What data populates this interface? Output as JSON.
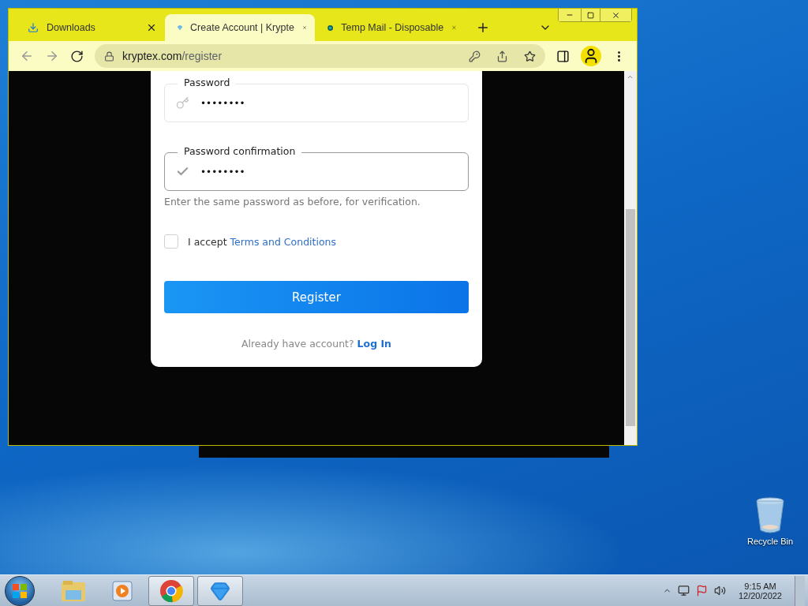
{
  "browser": {
    "tabs": [
      {
        "title": "Downloads",
        "kind": "download",
        "selected": false
      },
      {
        "title": "Create Account | Krypte",
        "kind": "gem",
        "selected": true
      },
      {
        "title": "Temp Mail - Disposable",
        "kind": "mail",
        "selected": false
      }
    ],
    "url_host": "kryptex.com",
    "url_path": "/register"
  },
  "form": {
    "fields": [
      {
        "label": "Password",
        "value": "••••••••",
        "kind": "key",
        "focused": false
      },
      {
        "label": "Password confirmation",
        "value": "••••••••",
        "kind": "check",
        "focused": true
      }
    ],
    "hint": "Enter the same password as before, for verification.",
    "terms": {
      "checked": false,
      "text": "I accept",
      "link": "Terms and Conditions"
    },
    "submit": "Register",
    "login_prompt": "Already have account?",
    "login_link": "Log In"
  },
  "desktop": {
    "icons": [
      {
        "label": "Recycle Bin"
      }
    ]
  },
  "taskbar": {
    "apps": [
      {
        "kind": "folder",
        "running": false
      },
      {
        "kind": "media",
        "running": false
      },
      {
        "kind": "chrome",
        "running": true
      },
      {
        "kind": "gem",
        "running": true
      }
    ],
    "time": "9:15 AM",
    "date": "12/20/2022"
  }
}
